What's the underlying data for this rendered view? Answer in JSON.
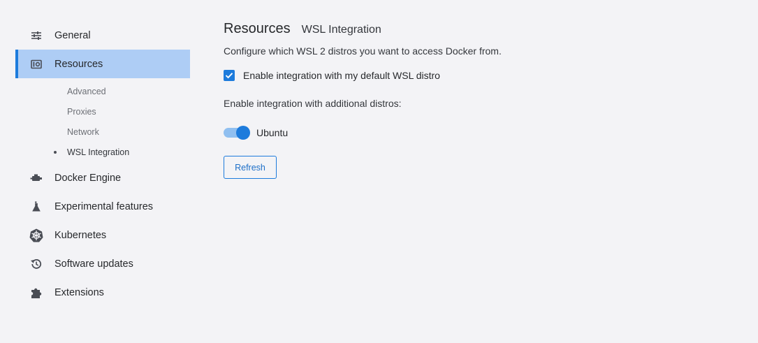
{
  "sidebar": {
    "items": [
      {
        "label": "General",
        "icon": "sliders-icon"
      },
      {
        "label": "Resources",
        "icon": "resources-icon"
      },
      {
        "label": "Docker Engine",
        "icon": "docker-engine-icon"
      },
      {
        "label": "Experimental features",
        "icon": "flask-icon"
      },
      {
        "label": "Kubernetes",
        "icon": "kubernetes-icon"
      },
      {
        "label": "Software updates",
        "icon": "history-icon"
      },
      {
        "label": "Extensions",
        "icon": "puzzle-icon"
      }
    ],
    "resources_sub": [
      "Advanced",
      "Proxies",
      "Network",
      "WSL Integration"
    ]
  },
  "main": {
    "title": "Resources",
    "subtitle": "WSL Integration",
    "description": "Configure which WSL 2 distros you want to access Docker from.",
    "default_distro_label": "Enable integration with my default WSL distro",
    "default_distro_checked": true,
    "additional_label": "Enable integration with additional distros:",
    "distros": [
      {
        "name": "Ubuntu",
        "enabled": true
      }
    ],
    "refresh_label": "Refresh"
  },
  "colors": {
    "accent": "#1d7bdc",
    "active_bg": "#aecdf5",
    "background": "#f3f3f6"
  }
}
